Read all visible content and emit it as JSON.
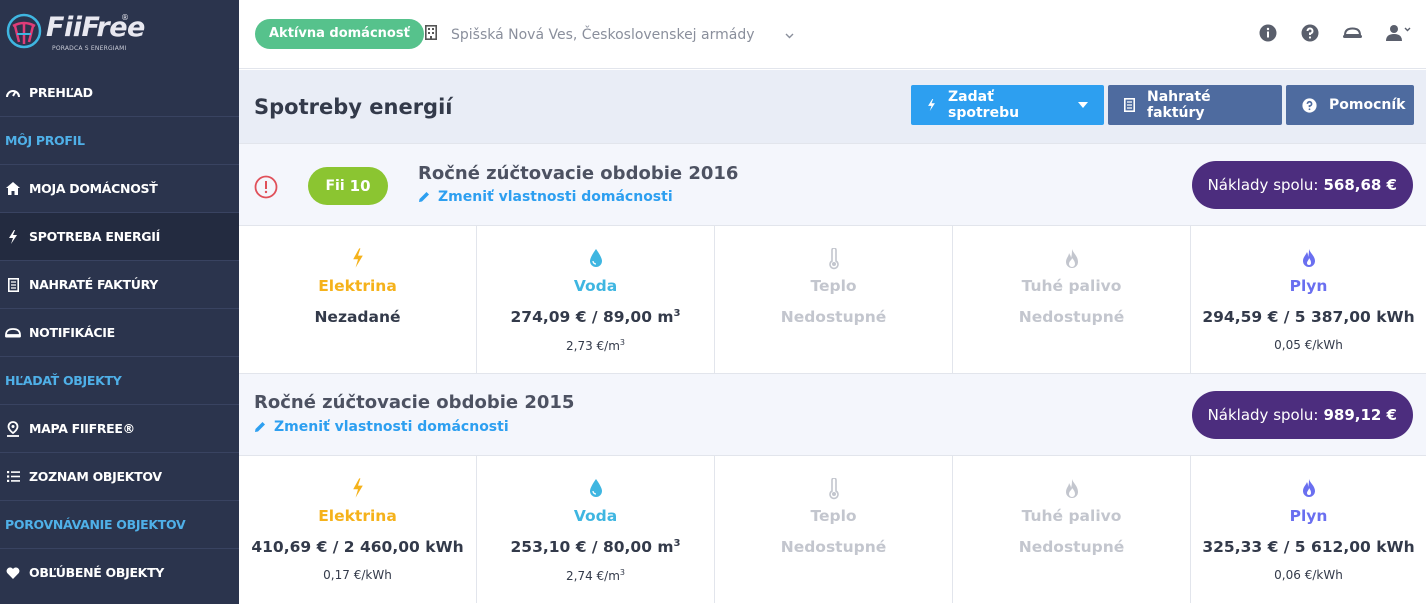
{
  "logo": {
    "name": "FiiFree",
    "reg": "®",
    "tagline": "PORADCA S ENERGIAMI"
  },
  "sidebar": {
    "items": [
      {
        "label": "PREHĽAD",
        "icon": "gauge-icon"
      },
      {
        "label": "MÔJ PROFIL",
        "section": true
      },
      {
        "label": "MOJA DOMÁCNOSŤ",
        "icon": "home-icon"
      },
      {
        "label": "SPOTREBA ENERGIÍ",
        "icon": "bolt-icon",
        "active": true
      },
      {
        "label": "NAHRATÉ FAKTÚRY",
        "icon": "document-icon"
      },
      {
        "label": "NOTIFIKÁCIE",
        "icon": "bell-icon"
      },
      {
        "label": "HĽADAŤ OBJEKTY",
        "section": true
      },
      {
        "label": "MAPA FIIFREE®",
        "icon": "map-pin-icon"
      },
      {
        "label": "ZOZNAM OBJEKTOV",
        "icon": "list-icon"
      },
      {
        "label": "POROVNÁVANIE OBJEKTOV",
        "section": true
      },
      {
        "label": "OBĽÚBENÉ OBJEKTY",
        "icon": "heart-icon"
      }
    ]
  },
  "topbar": {
    "status_badge": "Aktívna domácnosť",
    "address": "Spišská Nová Ves, Československej armády"
  },
  "header": {
    "title": "Spotreby energií",
    "btn_add": "Zadať spotrebu",
    "btn_invoices": "Nahraté faktúry",
    "btn_helper": "Pomocník"
  },
  "periods": [
    {
      "fii_label": "Fii",
      "fii_value": "10",
      "title": "Ročné zúčtovacie obdobie 2016",
      "edit_link": "Zmeniť vlastnosti domácnosti",
      "cost_label": "Náklady spolu:",
      "cost_value": "568,68 €",
      "energies": [
        {
          "name": "Elektrina",
          "value": "Nezadané",
          "unit": ""
        },
        {
          "name": "Voda",
          "value": "274,09 € /  89,00 m",
          "sup": "3",
          "unit": "2,73 €/m",
          "unit_sup": "3"
        },
        {
          "name": "Teplo",
          "value": "Nedostupné",
          "unit": ""
        },
        {
          "name": "Tuhé palivo",
          "value": "Nedostupné",
          "unit": ""
        },
        {
          "name": "Plyn",
          "value": "294,59 € /  5 387,00 kWh",
          "unit": "0,05 €/kWh"
        }
      ]
    },
    {
      "title": "Ročné zúčtovacie obdobie 2015",
      "edit_link": "Zmeniť vlastnosti domácnosti",
      "cost_label": "Náklady spolu:",
      "cost_value": "989,12 €",
      "energies": [
        {
          "name": "Elektrina",
          "value": "410,69 € /  2 460,00 kWh",
          "unit": "0,17 €/kWh"
        },
        {
          "name": "Voda",
          "value": "253,10 € /  80,00 m",
          "sup": "3",
          "unit": "2,74 €/m",
          "unit_sup": "3"
        },
        {
          "name": "Teplo",
          "value": "Nedostupné",
          "unit": ""
        },
        {
          "name": "Tuhé palivo",
          "value": "Nedostupné",
          "unit": ""
        },
        {
          "name": "Plyn",
          "value": "325,33 € /  5 612,00 kWh",
          "unit": "0,06 €/kWh"
        }
      ]
    }
  ],
  "colors": {
    "sidebar_bg": "#2b344d",
    "accent_blue": "#2d9ff0",
    "green": "#56c28c",
    "fii_green": "#8bc531",
    "cost_purple": "#4c2d7e",
    "electric": "#f5b21b",
    "water": "#3fb6e1",
    "gas": "#6a6ff0",
    "na": "#c3c6ce"
  }
}
